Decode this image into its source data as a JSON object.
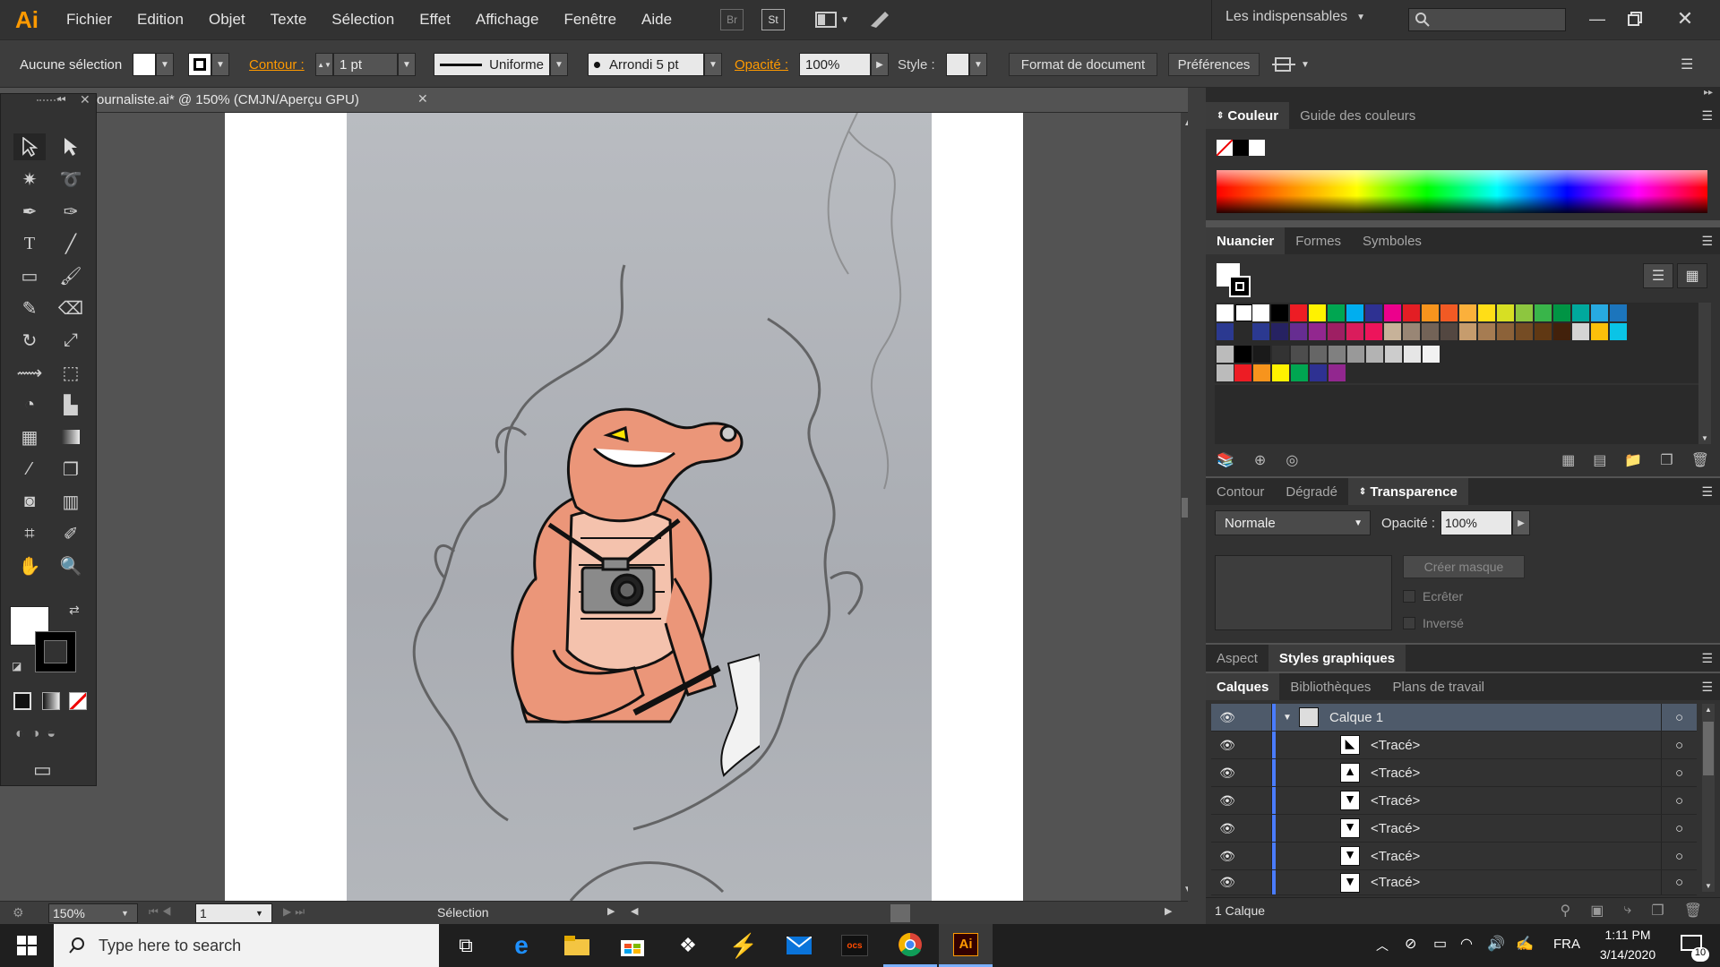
{
  "app": {
    "logo": "Ai",
    "workspace": "Les indispensables"
  },
  "menu": [
    "Fichier",
    "Edition",
    "Objet",
    "Texte",
    "Sélection",
    "Effet",
    "Affichage",
    "Fenêtre",
    "Aide"
  ],
  "menu_extras": {
    "bridge": "Br",
    "stock": "St"
  },
  "control": {
    "selection_label": "Aucune sélection",
    "contour_label": "Contour :",
    "contour_weight": "1 pt",
    "stroke_profile": "Uniforme",
    "brush": "Arrondi 5 pt",
    "opacity_label": "Opacité :",
    "opacity_value": "100%",
    "style_label": "Style :",
    "doc_format_button": "Format de document",
    "preferences_button": "Préférences"
  },
  "document": {
    "tab_title": "ournaliste.ai* @ 150% (CMJN/Aperçu GPU)"
  },
  "status": {
    "zoom": "150%",
    "page": "1",
    "tool_label": "Sélection"
  },
  "panels": {
    "color": {
      "tabs": [
        "Couleur",
        "Guide des couleurs"
      ]
    },
    "swatches": {
      "tabs": [
        "Nuancier",
        "Formes",
        "Symboles"
      ]
    },
    "transparency": {
      "tabs": [
        "Contour",
        "Dégradé",
        "Transparence"
      ],
      "blend_mode": "Normale",
      "opacity_label": "Opacité :",
      "opacity_value": "100%",
      "create_mask": "Créer masque",
      "clip": "Ecrêter",
      "invert": "Inversé"
    },
    "appearance": {
      "tabs": [
        "Aspect",
        "Styles graphiques"
      ]
    },
    "layers": {
      "tabs": [
        "Calques",
        "Bibliothèques",
        "Plans de travail"
      ],
      "items": [
        {
          "label": "Calque 1"
        },
        {
          "label": "<Tracé>"
        },
        {
          "label": "<Tracé>"
        },
        {
          "label": "<Tracé>"
        },
        {
          "label": "<Tracé>"
        },
        {
          "label": "<Tracé>"
        },
        {
          "label": "<Tracé>"
        }
      ],
      "footer": "1 Calque"
    }
  },
  "swatch_colors": {
    "row1": [
      "#ffffff",
      "#000000",
      "#ed1c24",
      "#fff200",
      "#00a651",
      "#00aeef",
      "#2e3192",
      "#ec008c",
      "#e31e24",
      "#f7941d",
      "#f15a24",
      "#fbb03b",
      "#ffde17",
      "#d7df23",
      "#8dc63f",
      "#39b54a",
      "#009444",
      "#00a99d",
      "#27aae1",
      "#1c75bc"
    ],
    "row2": [
      "#2b3990",
      "#262262",
      "#662d91",
      "#92278f",
      "#9e1f63",
      "#da1c5c",
      "#ed145b",
      "#c7b299",
      "#998675",
      "#736357",
      "#534741",
      "#c69c6d",
      "#a67c52",
      "#8c6239",
      "#754c24",
      "#603813",
      "#42210b",
      "#d4d4d4",
      "#fcc00a",
      "#0ac4e6"
    ],
    "row3": [
      "#000000",
      "#1a1a1a",
      "#333333",
      "#4d4d4d",
      "#666666",
      "#808080",
      "#999999",
      "#b3b3b3",
      "#cccccc",
      "#e6e6e6",
      "#f2f2f2"
    ],
    "row4": [
      "#ed1c24",
      "#f7941d",
      "#fff200",
      "#00a651",
      "#2e3192",
      "#92278f"
    ]
  },
  "taskbar": {
    "search_placeholder": "Type here to search",
    "lang": "FRA",
    "time": "1:11 PM",
    "date": "3/14/2020",
    "notifications": "10"
  }
}
